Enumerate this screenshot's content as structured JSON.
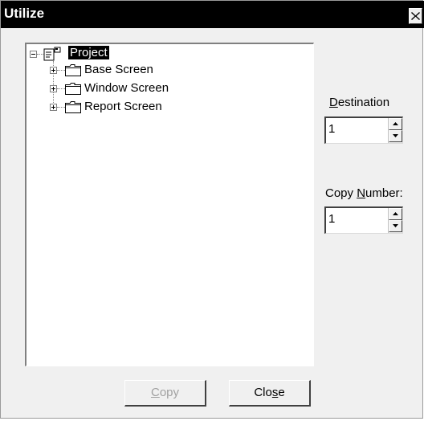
{
  "window": {
    "title": "Utilize"
  },
  "tree": {
    "root": {
      "label": "Project",
      "expanded": true,
      "selected": true
    },
    "children": [
      {
        "label": "Base Screen",
        "expanded": false
      },
      {
        "label": "Window Screen",
        "expanded": false
      },
      {
        "label": "Report Screen",
        "expanded": false
      }
    ]
  },
  "destination": {
    "label": "Destination",
    "value": "1"
  },
  "copy_number": {
    "label": "Copy Number:",
    "value": "1"
  },
  "buttons": {
    "copy": {
      "label": "Copy",
      "enabled": false
    },
    "close": {
      "label": "Close",
      "enabled": true
    }
  },
  "colors": {
    "titlebar": "#000000",
    "selection": "#000000",
    "dialog": "#f0f0f0"
  }
}
